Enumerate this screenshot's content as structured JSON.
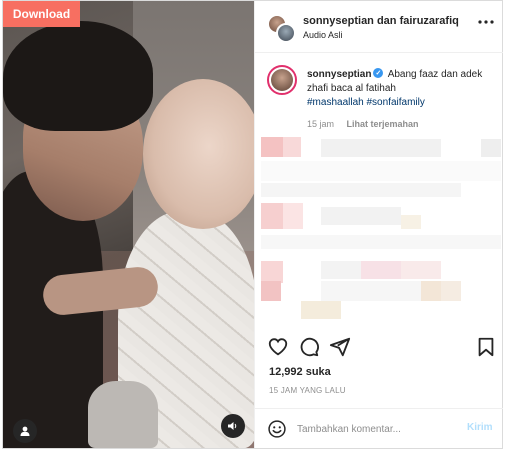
{
  "download": {
    "label": "Download"
  },
  "header": {
    "title": "sonnyseptian dan fairuzarafiq",
    "audio": "Audio Asli"
  },
  "caption": {
    "username": "sonnyseptian",
    "text": "Abang faaz dan adek zhafi baca al fatihah",
    "hashtags": "#mashaallah #sonfaifamily",
    "time": "15 jam",
    "translate": "Lihat terjemahan"
  },
  "stats": {
    "likes": "12,992 suka",
    "posted": "15 JAM YANG LALU"
  },
  "comment": {
    "placeholder": "Tambahkan komentar...",
    "post_label": "Kirim"
  },
  "colors": {
    "download_bg": "#f76f61",
    "hashtag": "#00376b",
    "verified": "#3897f0",
    "post_disabled": "#b2dffc"
  }
}
